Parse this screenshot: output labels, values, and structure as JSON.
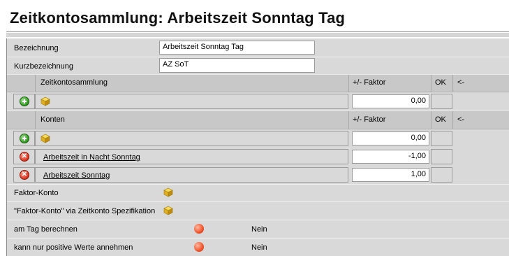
{
  "title": "Zeitkontosammlung: Arbeitszeit Sonntag Tag",
  "fields": {
    "bezeichnung_label": "Bezeichnung",
    "bezeichnung_value": "Arbeitszeit Sonntag Tag",
    "kurzbezeichnung_label": "Kurzbezeichnung",
    "kurzbezeichnung_value": "AZ SoT"
  },
  "zks_table": {
    "col_name": "Zeitkontosammlung",
    "col_factor": "+/- Faktor",
    "col_ok": "OK",
    "col_back": "<-",
    "new_row_factor": "0,00"
  },
  "konten_table": {
    "col_name": "Konten",
    "col_factor": "+/- Faktor",
    "col_ok": "OK",
    "col_back": "<-",
    "new_row_factor": "0,00",
    "rows": [
      {
        "name": "Arbeitszeit in Nacht Sonntag",
        "factor": "-1,00"
      },
      {
        "name": "Arbeitszeit Sonntag",
        "factor": "1,00"
      }
    ]
  },
  "properties": {
    "faktor_konto_label": "Faktor-Konto",
    "faktor_konto_spez_label": "\"Faktor-Konto\" via Zeitkonto Spezifikation",
    "am_tag_label": "am Tag berechnen",
    "am_tag_value": "Nein",
    "positive_label": "kann nur positive Werte annehmen",
    "positive_value": "Nein"
  },
  "colors": {
    "add_icon": "#2e9a1e",
    "delete_icon": "#d8331c",
    "status_dot": "#f0542c",
    "cube": "#e0b020"
  },
  "icons": [
    "add-icon",
    "delete-icon",
    "cube-icon",
    "status-dot-icon"
  ]
}
